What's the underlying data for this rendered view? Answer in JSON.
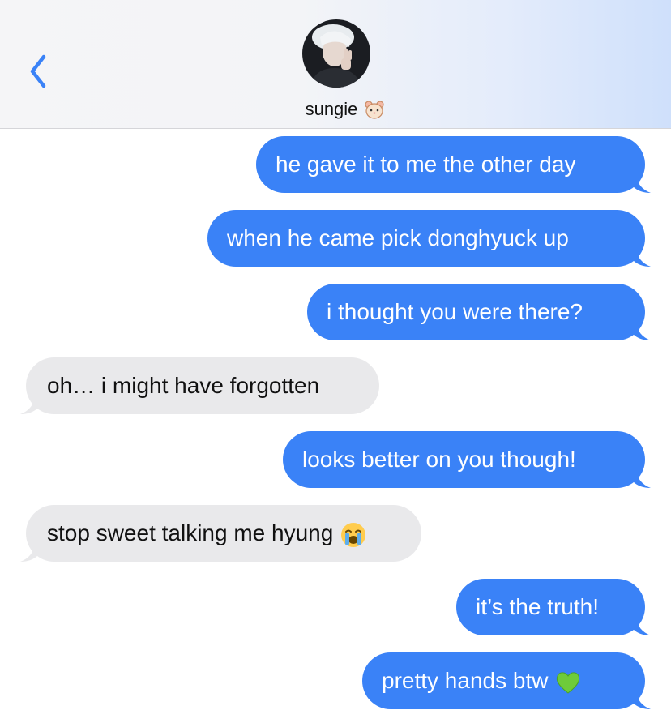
{
  "header": {
    "contact_name": "sungie",
    "contact_emoji": "hamster-emoji",
    "back_icon": "chevron-left-icon",
    "accent": "#3a82f7"
  },
  "messages": [
    {
      "type": "sent",
      "text": "he gave it to me the other day"
    },
    {
      "type": "sent",
      "text": "when he came pick donghyuck up"
    },
    {
      "type": "sent",
      "text": "i thought you were there?"
    },
    {
      "type": "received",
      "text": "oh… i might have forgotten"
    },
    {
      "type": "sent",
      "text": "looks better on you though!"
    },
    {
      "type": "received",
      "text": "stop sweet talking me hyung",
      "emoji": "loudly-crying-emoji"
    },
    {
      "type": "sent",
      "text": "it’s the truth!"
    },
    {
      "type": "sent",
      "text": "pretty hands btw",
      "emoji": "green-heart-emoji"
    }
  ],
  "colors": {
    "sent_bubble": "#3a82f7",
    "received_bubble": "#e9e9eb"
  }
}
